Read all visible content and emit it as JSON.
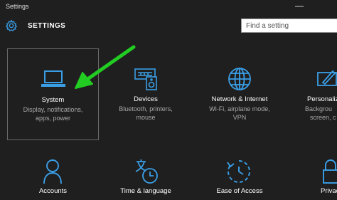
{
  "window": {
    "title": "Settings",
    "minimize": "—"
  },
  "header": {
    "title": "SETTINGS",
    "icon": "gear-icon"
  },
  "search": {
    "placeholder": "Find a setting",
    "value": ""
  },
  "accent_color": "#3a9ee6",
  "annotation_arrow_color": "#22cc22",
  "tiles": [
    {
      "id": "system",
      "icon": "laptop-icon",
      "name": "System",
      "desc1": "Display, notifications,",
      "desc2": "apps, power",
      "selected": true
    },
    {
      "id": "devices",
      "icon": "keyboard-speaker-icon",
      "name": "Devices",
      "desc1": "Bluetooth, printers,",
      "desc2": "mouse",
      "selected": false
    },
    {
      "id": "network",
      "icon": "globe-icon",
      "name": "Network & Internet",
      "desc1": "Wi-Fi, airplane mode,",
      "desc2": "VPN",
      "selected": false
    },
    {
      "id": "personalization",
      "icon": "pen-screen-icon",
      "name": "Personaliz",
      "desc1": "Backgrou",
      "desc2": "screen, c",
      "selected": false
    },
    {
      "id": "accounts",
      "icon": "person-icon",
      "name": "Accounts",
      "selected": false
    },
    {
      "id": "time",
      "icon": "time-language-icon",
      "name": "Time & language",
      "selected": false
    },
    {
      "id": "ease",
      "icon": "ease-of-access-icon",
      "name": "Ease of Access",
      "selected": false
    },
    {
      "id": "privacy",
      "icon": "lock-icon",
      "name": "Privac",
      "selected": false
    }
  ]
}
